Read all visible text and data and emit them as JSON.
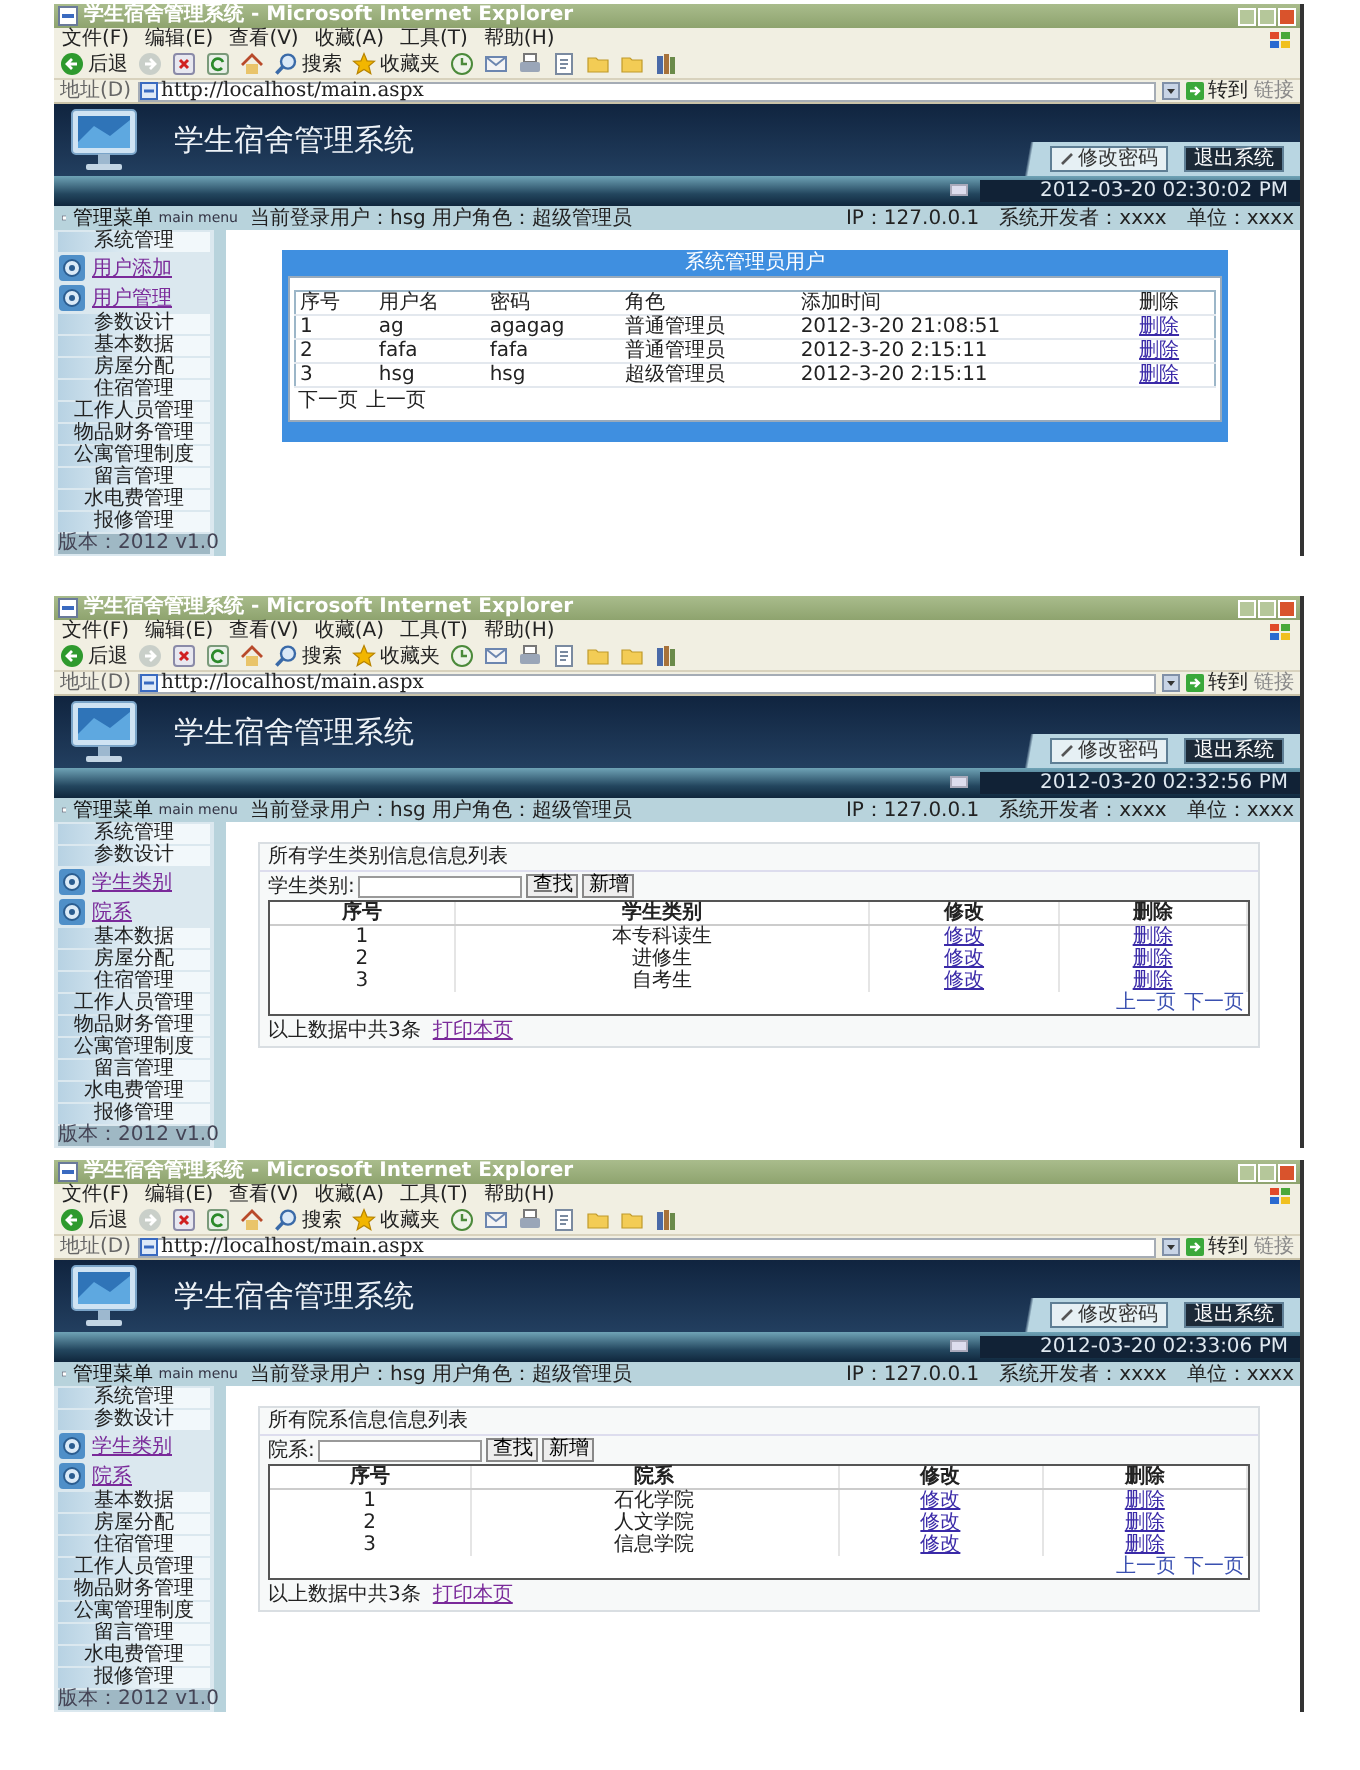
{
  "screens": [
    {
      "browser": {
        "title": "学生宿舍管理系统 - Microsoft Internet Explorer",
        "menu": [
          "文件(F)",
          "编辑(E)",
          "查看(V)",
          "收藏(A)",
          "工具(T)",
          "帮助(H)"
        ],
        "toolbar": [
          {
            "kind": "back",
            "label": "后退"
          },
          {
            "kind": "forward"
          },
          {
            "kind": "stop"
          },
          {
            "kind": "refresh"
          },
          {
            "kind": "home"
          },
          {
            "kind": "search",
            "label": "搜索"
          },
          {
            "kind": "favorites",
            "label": "收藏夹"
          },
          {
            "kind": "history"
          },
          {
            "kind": "mail"
          },
          {
            "kind": "print"
          },
          {
            "kind": "edit"
          },
          {
            "kind": "folder"
          },
          {
            "kind": "folder"
          },
          {
            "kind": "book"
          }
        ],
        "address_label": "地址(D)",
        "url": "http://localhost/main.aspx",
        "go": "转到",
        "links": "链接"
      },
      "app": {
        "title": "学生宿舍管理系统",
        "buttons": [
          "修改密码",
          "退出系统"
        ],
        "datetime": "2012-03-20 02:30:02 PM",
        "menu_title": "管理菜单",
        "menu_subtitle": "main menu",
        "login": "当前登录用户：hsg  用户角色：超级管理员",
        "info": [
          "IP：127.0.0.1",
          "系统开发者：xxxx",
          "单位：xxxx"
        ]
      },
      "sidebar": {
        "items": [
          {
            "label": "系统管理",
            "kind": "bar"
          },
          {
            "label": "用户添加",
            "kind": "icon"
          },
          {
            "label": "用户管理",
            "kind": "icon"
          },
          {
            "label": "参数设计",
            "kind": "bar"
          },
          {
            "label": "基本数据",
            "kind": "bar"
          },
          {
            "label": "房屋分配",
            "kind": "bar"
          },
          {
            "label": "住宿管理",
            "kind": "bar"
          },
          {
            "label": "工作人员管理",
            "kind": "bar"
          },
          {
            "label": "物品财务管理",
            "kind": "bar"
          },
          {
            "label": "公寓管理制度",
            "kind": "bar"
          },
          {
            "label": "留言管理",
            "kind": "bar"
          },
          {
            "label": "水电费管理",
            "kind": "bar"
          },
          {
            "label": "报修管理",
            "kind": "bar"
          }
        ],
        "version": "版本：2012 v1.0"
      },
      "content": {
        "kind": "panel",
        "title": "系统管理员用户",
        "columns": [
          {
            "label": "序号",
            "kind": "text"
          },
          {
            "label": "用户名",
            "kind": "text"
          },
          {
            "label": "密码",
            "kind": "text"
          },
          {
            "label": "角色",
            "kind": "text"
          },
          {
            "label": "添加时间",
            "kind": "text"
          },
          {
            "label": "删除",
            "kind": "link"
          }
        ],
        "rows": [
          [
            "1",
            "ag",
            "agagag",
            "普通管理员",
            "2012-3-20 21:08:51",
            "删除"
          ],
          [
            "2",
            "fafa",
            "fafa",
            "普通管理员",
            "2012-3-20 2:15:11",
            "删除"
          ],
          [
            "3",
            "hsg",
            "hsg",
            "超级管理员",
            "2012-3-20 2:15:11",
            "删除"
          ]
        ],
        "pager": [
          "下一页",
          "上一页"
        ]
      }
    },
    {
      "browser": {
        "title": "学生宿舍管理系统 - Microsoft Internet Explorer",
        "menu": [
          "文件(F)",
          "编辑(E)",
          "查看(V)",
          "收藏(A)",
          "工具(T)",
          "帮助(H)"
        ],
        "toolbar": [
          {
            "kind": "back",
            "label": "后退"
          },
          {
            "kind": "forward"
          },
          {
            "kind": "stop"
          },
          {
            "kind": "refresh"
          },
          {
            "kind": "home"
          },
          {
            "kind": "search",
            "label": "搜索"
          },
          {
            "kind": "favorites",
            "label": "收藏夹"
          },
          {
            "kind": "history"
          },
          {
            "kind": "mail"
          },
          {
            "kind": "print"
          },
          {
            "kind": "edit"
          },
          {
            "kind": "folder"
          },
          {
            "kind": "folder"
          },
          {
            "kind": "book"
          }
        ],
        "address_label": "地址(D)",
        "url": "http://localhost/main.aspx",
        "go": "转到",
        "links": "链接"
      },
      "app": {
        "title": "学生宿舍管理系统",
        "buttons": [
          "修改密码",
          "退出系统"
        ],
        "datetime": "2012-03-20 02:32:56 PM",
        "menu_title": "管理菜单",
        "menu_subtitle": "main menu",
        "login": "当前登录用户：hsg  用户角色：超级管理员",
        "info": [
          "IP：127.0.0.1",
          "系统开发者：xxxx",
          "单位：xxxx"
        ]
      },
      "sidebar": {
        "items": [
          {
            "label": "系统管理",
            "kind": "bar"
          },
          {
            "label": "参数设计",
            "kind": "bar"
          },
          {
            "label": "学生类别",
            "kind": "icon"
          },
          {
            "label": "院系",
            "kind": "icon"
          },
          {
            "label": "基本数据",
            "kind": "bar"
          },
          {
            "label": "房屋分配",
            "kind": "bar"
          },
          {
            "label": "住宿管理",
            "kind": "bar"
          },
          {
            "label": "工作人员管理",
            "kind": "bar"
          },
          {
            "label": "物品财务管理",
            "kind": "bar"
          },
          {
            "label": "公寓管理制度",
            "kind": "bar"
          },
          {
            "label": "留言管理",
            "kind": "bar"
          },
          {
            "label": "水电费管理",
            "kind": "bar"
          },
          {
            "label": "报修管理",
            "kind": "bar"
          }
        ],
        "version": "版本：2012 v1.0"
      },
      "content": {
        "kind": "list",
        "title": "所有学生类别信息信息列表",
        "search_label": "学生类别:",
        "buttons": [
          "查找",
          "新增"
        ],
        "columns": [
          {
            "label": "序号",
            "kind": "text"
          },
          {
            "label": "学生类别",
            "kind": "text"
          },
          {
            "label": "修改",
            "kind": "link"
          },
          {
            "label": "删除",
            "kind": "link"
          }
        ],
        "rows": [
          [
            "1",
            "本专科读生",
            "修改",
            "删除"
          ],
          [
            "2",
            "进修生",
            "修改",
            "删除"
          ],
          [
            "3",
            "自考生",
            "修改",
            "删除"
          ]
        ],
        "pager": [
          "上一页",
          "下一页"
        ],
        "summary": "以上数据中共3条",
        "print": "打印本页"
      }
    },
    {
      "browser": {
        "title": "学生宿舍管理系统 - Microsoft Internet Explorer",
        "menu": [
          "文件(F)",
          "编辑(E)",
          "查看(V)",
          "收藏(A)",
          "工具(T)",
          "帮助(H)"
        ],
        "toolbar": [
          {
            "kind": "back",
            "label": "后退"
          },
          {
            "kind": "forward"
          },
          {
            "kind": "stop"
          },
          {
            "kind": "refresh"
          },
          {
            "kind": "home"
          },
          {
            "kind": "search",
            "label": "搜索"
          },
          {
            "kind": "favorites",
            "label": "收藏夹"
          },
          {
            "kind": "history"
          },
          {
            "kind": "mail"
          },
          {
            "kind": "print"
          },
          {
            "kind": "edit"
          },
          {
            "kind": "folder"
          },
          {
            "kind": "folder"
          },
          {
            "kind": "book"
          }
        ],
        "address_label": "地址(D)",
        "url": "http://localhost/main.aspx",
        "go": "转到",
        "links": "链接"
      },
      "app": {
        "title": "学生宿舍管理系统",
        "buttons": [
          "修改密码",
          "退出系统"
        ],
        "datetime": "2012-03-20 02:33:06 PM",
        "menu_title": "管理菜单",
        "menu_subtitle": "main menu",
        "login": "当前登录用户：hsg  用户角色：超级管理员",
        "info": [
          "IP：127.0.0.1",
          "系统开发者：xxxx",
          "单位：xxxx"
        ]
      },
      "sidebar": {
        "items": [
          {
            "label": "系统管理",
            "kind": "bar"
          },
          {
            "label": "参数设计",
            "kind": "bar"
          },
          {
            "label": "学生类别",
            "kind": "icon"
          },
          {
            "label": "院系",
            "kind": "icon"
          },
          {
            "label": "基本数据",
            "kind": "bar"
          },
          {
            "label": "房屋分配",
            "kind": "bar"
          },
          {
            "label": "住宿管理",
            "kind": "bar"
          },
          {
            "label": "工作人员管理",
            "kind": "bar"
          },
          {
            "label": "物品财务管理",
            "kind": "bar"
          },
          {
            "label": "公寓管理制度",
            "kind": "bar"
          },
          {
            "label": "留言管理",
            "kind": "bar"
          },
          {
            "label": "水电费管理",
            "kind": "bar"
          },
          {
            "label": "报修管理",
            "kind": "bar"
          }
        ],
        "version": "版本：2012 v1.0"
      },
      "content": {
        "kind": "list",
        "title": "所有院系信息信息列表",
        "search_label": "院系:",
        "buttons": [
          "查找",
          "新增"
        ],
        "columns": [
          {
            "label": "序号",
            "kind": "text"
          },
          {
            "label": "院系",
            "kind": "text"
          },
          {
            "label": "修改",
            "kind": "link"
          },
          {
            "label": "删除",
            "kind": "link"
          }
        ],
        "rows": [
          [
            "1",
            "石化学院",
            "修改",
            "删除"
          ],
          [
            "2",
            "人文学院",
            "修改",
            "删除"
          ],
          [
            "3",
            "信息学院",
            "修改",
            "删除"
          ]
        ],
        "pager": [
          "上一页",
          "下一页"
        ],
        "summary": "以上数据中共3条",
        "print": "打印本页"
      }
    }
  ]
}
